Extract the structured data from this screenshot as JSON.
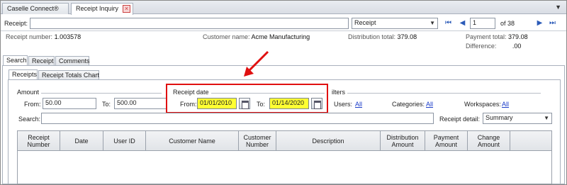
{
  "doc_tabs": [
    {
      "label": "Caselle Connect®"
    },
    {
      "label": "Receipt Inquiry"
    }
  ],
  "toolbar": {
    "receipt_label": "Receipt:",
    "receipt_value": "",
    "type_select": "Receipt",
    "page_value": "1",
    "page_of": "of 38"
  },
  "info": {
    "receipt_number_label": "Receipt number:",
    "receipt_number": "1.003578",
    "customer_name_label": "Customer name:",
    "customer_name": "Acme Manufacturing",
    "distribution_total_label": "Distribution total:",
    "distribution_total": "379.08",
    "payment_total_label": "Payment total:",
    "payment_total": "379.08",
    "difference_label": "Difference:",
    "difference": ".00"
  },
  "main_tabs": [
    "Search",
    "Receipt",
    "Comments"
  ],
  "sub_tabs": [
    "Receipts",
    "Receipt Totals Chart"
  ],
  "amount": {
    "group_label": "Amount",
    "from_label": "From:",
    "from_value": "50.00",
    "to_label": "To:",
    "to_value": "500.00"
  },
  "receipt_date": {
    "group_label": "Receipt date",
    "from_label": "From:",
    "from_value": "01/01/2010",
    "to_label": "To:",
    "to_value": "01/14/2020"
  },
  "filters": {
    "group_label": "ilters",
    "users_label": "Users:",
    "users_value": "All",
    "categories_label": "Categories:",
    "categories_value": "All",
    "workspaces_label": "Workspaces:",
    "workspaces_value": "All"
  },
  "search": {
    "label": "Search:",
    "value": "",
    "receipt_detail_label": "Receipt detail:",
    "receipt_detail_value": "Summary"
  },
  "grid": {
    "columns": [
      "Receipt Number",
      "Date",
      "User ID",
      "Customer Name",
      "Customer Number",
      "Description",
      "Distribution Amount",
      "Payment Amount",
      "Change Amount"
    ]
  },
  "colors": {
    "highlight": "#ffff33",
    "annotation_red": "#e01010",
    "link_blue": "#1a3cc8"
  }
}
